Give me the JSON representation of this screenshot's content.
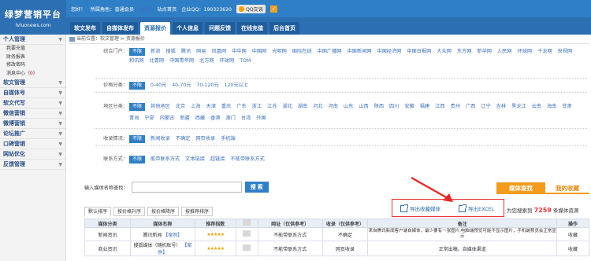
{
  "logo": {
    "title": "绿梦营销平台",
    "domain": "lvluonews.com"
  },
  "topbar": {
    "greeting": "您好！",
    "role": "所属角色：普通会员",
    "logout": "[退出]",
    "home": "站点首页",
    "qq_label": "企业QQ：190323620",
    "qq_button": "QQ交谈"
  },
  "nav": [
    {
      "label": "软文发布"
    },
    {
      "label": "自媒体发布"
    },
    {
      "label": "资源报价"
    },
    {
      "label": "个人信息"
    },
    {
      "label": "问题反馈"
    },
    {
      "label": "在线充值"
    },
    {
      "label": "后台首页"
    }
  ],
  "sidebar": {
    "sections": [
      {
        "label": "个人管理",
        "items": [
          "我要充值",
          "财务报表",
          "修改密码"
        ],
        "msg": {
          "label": "消息中心",
          "count": "0"
        }
      },
      {
        "label": "软文管理"
      },
      {
        "label": "自媒体号"
      },
      {
        "label": "软文代写"
      },
      {
        "label": "微信营销"
      },
      {
        "label": "微博营销"
      },
      {
        "label": "论坛推广"
      },
      {
        "label": "口碑营销"
      },
      {
        "label": "网站优化"
      },
      {
        "label": "反馈管理"
      }
    ]
  },
  "breadcrumb": "当前位置：软文管理 > 资源报价",
  "filters": [
    {
      "label": "综合门户：",
      "opts": [
        "不限",
        "新浪",
        "搜狐",
        "腾讯",
        "网易",
        "凤凰网",
        "中华网",
        "中国网",
        "光明网",
        "国际在线",
        "中国广播网",
        "中国新闻网",
        "中国经济网",
        "中国日报网",
        "大众网",
        "东方网",
        "新华网",
        "人民网",
        "环球网",
        "千龙网",
        "央视网",
        "和讯网",
        "北青网",
        "中国青年网",
        "北方网",
        "环球网",
        "TOM"
      ]
    },
    {
      "label": "价格分类：",
      "opts": [
        "不限",
        "0-40元",
        "40-70元",
        "70-120元",
        "120元以上"
      ]
    },
    {
      "label": "地区分类：",
      "opts": [
        "不限",
        "其他地区",
        "北京",
        "上海",
        "天津",
        "重庆",
        "广东",
        "浙江",
        "江苏",
        "湖北",
        "湖南",
        "河北",
        "河南",
        "山东",
        "山西",
        "陕西",
        "四川",
        "安徽",
        "福建",
        "江西",
        "贵州",
        "广西",
        "辽宁",
        "吉林",
        "黑龙江",
        "云南",
        "海南",
        "甘肃",
        "青海",
        "宁夏",
        "内蒙古",
        "新疆",
        "西藏",
        "香港",
        "澳门",
        "台湾",
        "外国"
      ]
    },
    {
      "label": "收录情况：",
      "opts": [
        "不限",
        "新闻收录",
        "不确定",
        "网页收录",
        "手机端"
      ]
    },
    {
      "label": "联系方式：",
      "opts": [
        "不限",
        "能带联系方式",
        "文本链接",
        "超链接",
        "不能带联系方式"
      ]
    }
  ],
  "search": {
    "label": "输入媒体名称查找：",
    "button": "搜 索"
  },
  "tabs_right": {
    "lookup": "媒体查找",
    "collect": "我的收藏"
  },
  "export": {
    "collect": "导出收藏媒体",
    "excel": "导出EXCEL"
  },
  "count": {
    "prefix": "为您搜索到",
    "num": "7259",
    "suffix": "条媒体资源"
  },
  "sorts": [
    "默认排序",
    "按价格升序",
    "按价格降序",
    "按推荐排序"
  ],
  "table": {
    "headers": [
      "媒体分类",
      "媒体名称",
      "推荐指数",
      "",
      "网址（仅供参考）",
      "收录（仅供参考）",
      "备注",
      "操作"
    ],
    "rows": [
      {
        "cat": "新闻资讯",
        "name": "腾讯新闻",
        "case": "【案例】",
        "stars": "★★★★★",
        "url": "不能带联系方式",
        "inc": "不确定",
        "note": "来自腾讯新闻客户端自媒体，最少要有一张图片,电脑端预览可能不显示图片，手机端预览会正常显示",
        "op": "收藏"
      },
      {
        "cat": "商业资讯",
        "name": "搜狐媒体（随机账号）",
        "case": "【案例】",
        "stars": "★★★★★",
        "url": "不能带联系方式",
        "inc": "网页收录",
        "note": "正常出稿，自媒体渠道",
        "op": "收藏"
      }
    ]
  }
}
